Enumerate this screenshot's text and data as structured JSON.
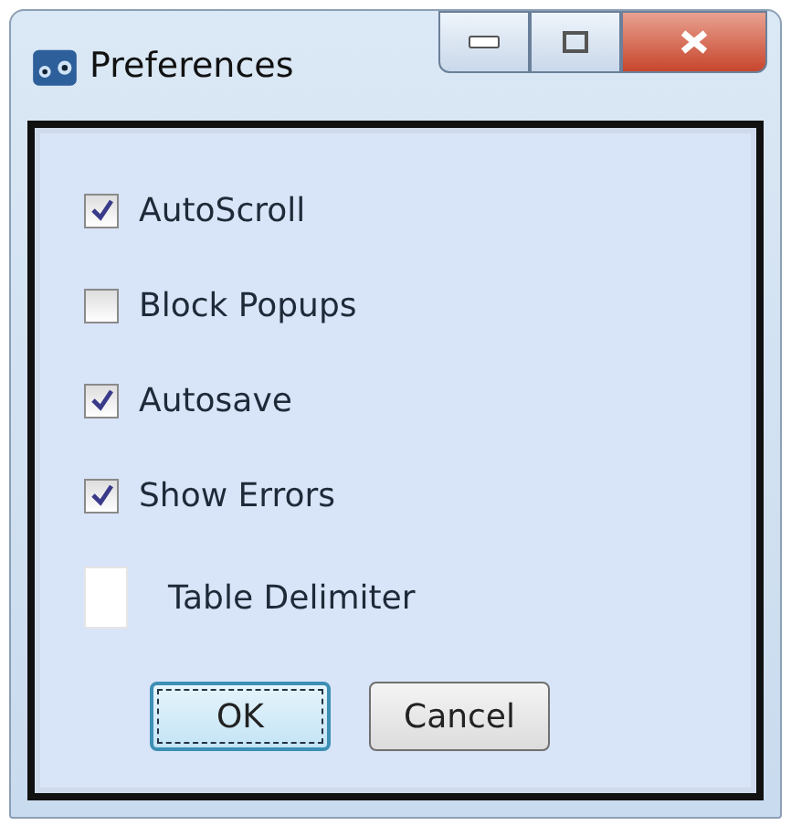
{
  "window": {
    "title": "Preferences"
  },
  "options": [
    {
      "label": "AutoScroll",
      "checked": true
    },
    {
      "label": "Block Popups",
      "checked": false
    },
    {
      "label": "Autosave",
      "checked": true
    },
    {
      "label": "Show Errors",
      "checked": true
    }
  ],
  "delimiter": {
    "label": "Table Delimiter"
  },
  "buttons": [
    {
      "label": "OK",
      "focused": true
    },
    {
      "label": "Cancel",
      "focused": false
    }
  ]
}
